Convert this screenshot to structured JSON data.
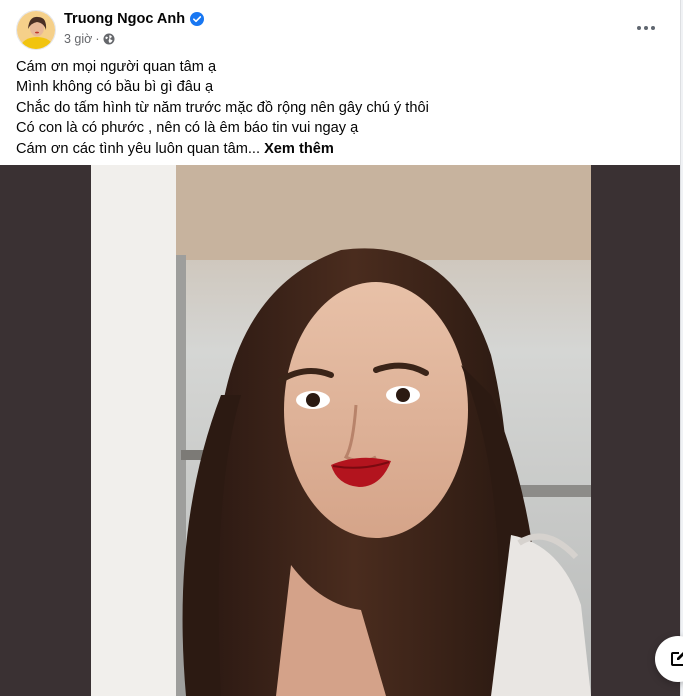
{
  "post": {
    "author": "Truong Ngoc Anh",
    "time": "3 giờ",
    "lines": [
      "Cám ơn mọi người quan tâm ạ",
      "Mình không có bầu bì gì đâu ạ",
      "Chắc do tấm hình từ năm trước mặc đồ  rộng nên gây chú ý thôi",
      "Có con là có phước , nên có là êm báo tin vui ngay ạ",
      "Cám ơn các tình yêu luôn quan tâm..."
    ],
    "see_more": "Xem thêm"
  },
  "icons": {
    "verified": "verified-badge-icon",
    "audience": "globe-icon",
    "more": "more-options-icon",
    "compose": "new-message-icon"
  },
  "colors": {
    "verified": "#1877f2",
    "text": "#050505",
    "secondary_text": "#65676b",
    "photo_letterbox": "#3a3133"
  }
}
